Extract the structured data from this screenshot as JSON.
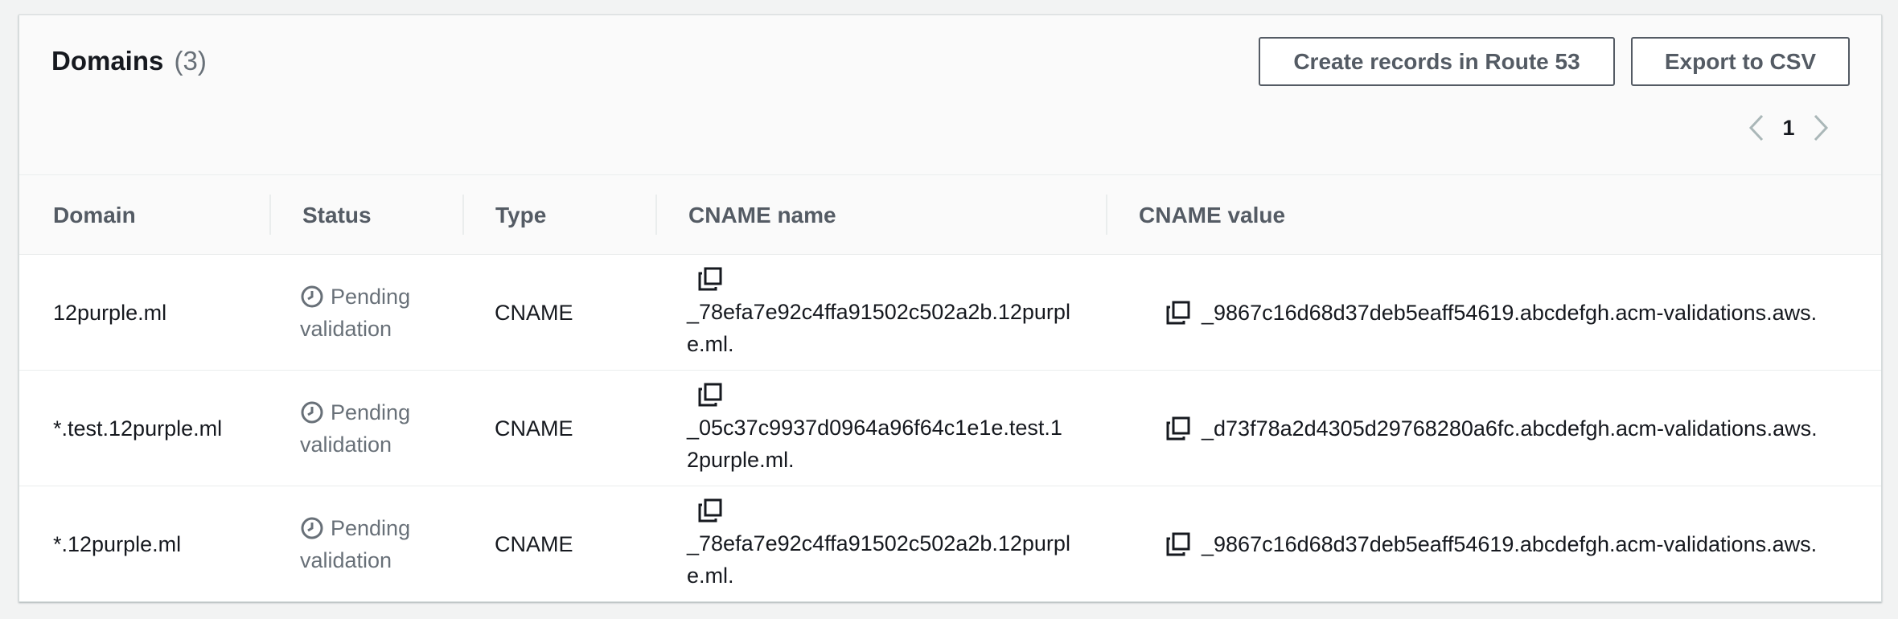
{
  "header": {
    "title": "Domains",
    "count": "(3)",
    "create_records_label": "Create records in Route 53",
    "export_label": "Export to CSV"
  },
  "pagination": {
    "current_page": "1"
  },
  "table": {
    "columns": [
      "Domain",
      "Status",
      "Type",
      "CNAME name",
      "CNAME value"
    ],
    "rows": [
      {
        "domain": "12purple.ml",
        "status_line1": "Pending",
        "status_line2": "validation",
        "type": "CNAME",
        "cname_name": "_78efa7e92c4ffa91502c502a2b.12purple.ml.",
        "cname_value": "_9867c16d68d37deb5eaff54619.abcdefgh.acm-validations.aws."
      },
      {
        "domain": "*.test.12purple.ml",
        "status_line1": "Pending",
        "status_line2": "validation",
        "type": "CNAME",
        "cname_name": "_05c37c9937d0964a96f64c1e1e.test.12purple.ml.",
        "cname_value": "_d73f78a2d4305d29768280a6fc.abcdefgh.acm-validations.aws."
      },
      {
        "domain": "*.12purple.ml",
        "status_line1": "Pending",
        "status_line2": "validation",
        "type": "CNAME",
        "cname_name": "_78efa7e92c4ffa91502c502a2b.12purple.ml.",
        "cname_value": "_9867c16d68d37deb5eaff54619.abcdefgh.acm-validations.aws."
      }
    ]
  },
  "icons": {
    "pending": "clock-icon",
    "copy": "copy-icon",
    "prev": "chevron-left-icon",
    "next": "chevron-right-icon"
  },
  "colors": {
    "pending_status": "#687078",
    "button_border": "#545b64"
  }
}
